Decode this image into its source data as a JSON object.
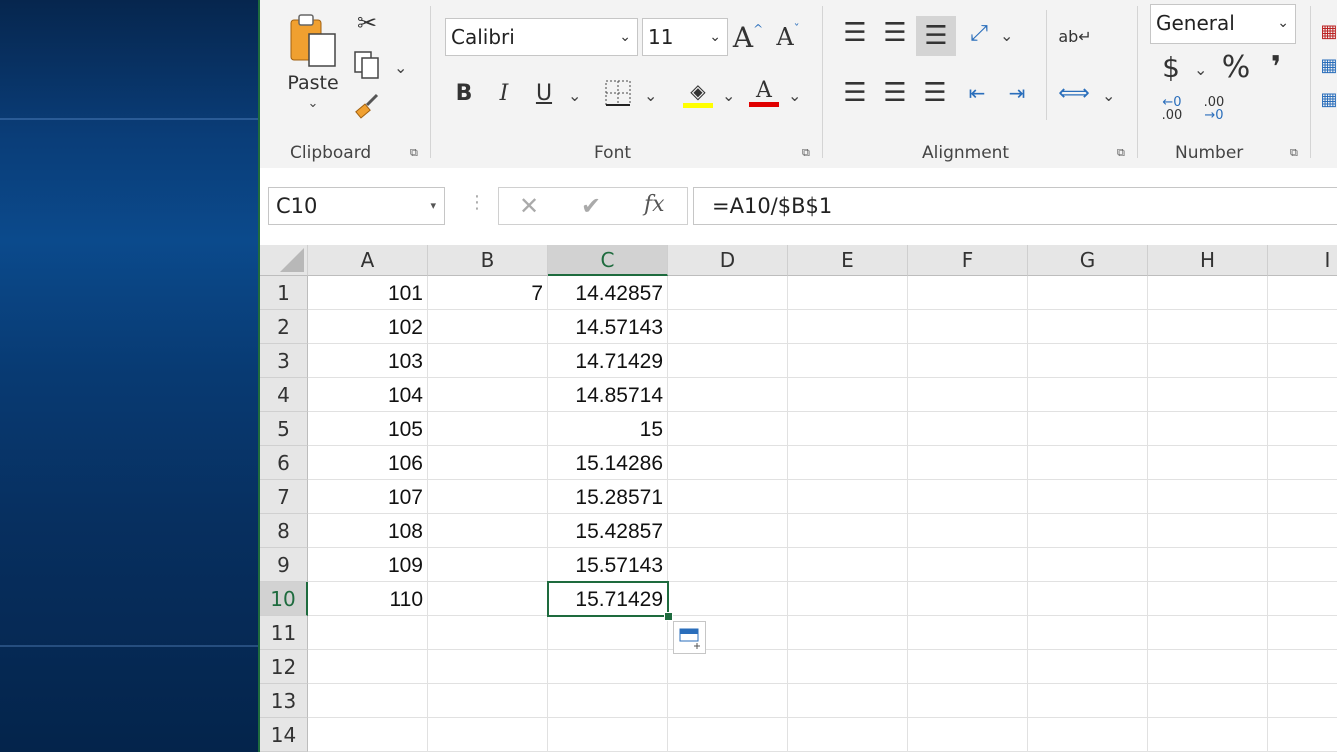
{
  "ribbon": {
    "clipboard": {
      "paste_label": "Paste",
      "group_label": "Clipboard"
    },
    "font": {
      "name": "Calibri",
      "size": "11",
      "group_label": "Font",
      "highlight_color": "#ffff00",
      "font_color": "#e00000"
    },
    "alignment": {
      "group_label": "Alignment"
    },
    "number": {
      "format": "General",
      "currency_symbol": "$",
      "percent_symbol": "%",
      "comma_symbol": "❜",
      "group_label": "Number",
      "inc_decimal": ".00",
      "dec_decimal": ".00"
    }
  },
  "formula_bar": {
    "name_box": "C10",
    "formula": "=A10/$B$1",
    "fx_label": "fx"
  },
  "sheet": {
    "columns": [
      "A",
      "B",
      "C",
      "D",
      "E",
      "F",
      "G",
      "H",
      "I"
    ],
    "selected_column": "C",
    "selected_row": 10,
    "rows": [
      {
        "n": "1",
        "A": "101",
        "B": "7",
        "C": "14.42857"
      },
      {
        "n": "2",
        "A": "102",
        "B": "",
        "C": "14.57143"
      },
      {
        "n": "3",
        "A": "103",
        "B": "",
        "C": "14.71429"
      },
      {
        "n": "4",
        "A": "104",
        "B": "",
        "C": "14.85714"
      },
      {
        "n": "5",
        "A": "105",
        "B": "",
        "C": "15"
      },
      {
        "n": "6",
        "A": "106",
        "B": "",
        "C": "15.14286"
      },
      {
        "n": "7",
        "A": "107",
        "B": "",
        "C": "15.28571"
      },
      {
        "n": "8",
        "A": "108",
        "B": "",
        "C": "15.42857"
      },
      {
        "n": "9",
        "A": "109",
        "B": "",
        "C": "15.57143"
      },
      {
        "n": "10",
        "A": "110",
        "B": "",
        "C": "15.71429"
      },
      {
        "n": "11",
        "A": "",
        "B": "",
        "C": ""
      },
      {
        "n": "12",
        "A": "",
        "B": "",
        "C": ""
      },
      {
        "n": "13",
        "A": "",
        "B": "",
        "C": ""
      },
      {
        "n": "14",
        "A": "",
        "B": "",
        "C": ""
      }
    ]
  },
  "colors": {
    "excel_green": "#1e6b3e"
  }
}
